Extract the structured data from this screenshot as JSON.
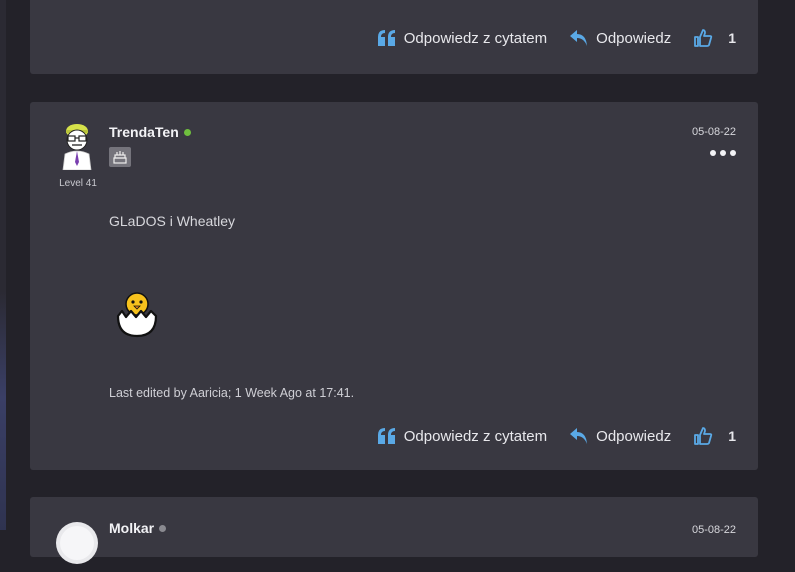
{
  "post1": {
    "actions": {
      "quote_label": "Odpowiedz z cytatem",
      "reply_label": "Odpowiedz",
      "like_count": "1"
    }
  },
  "post2": {
    "username": "TrendaTen",
    "level": "Level 41",
    "date": "05-08-22",
    "body": "GLaDOS i Wheatley",
    "edited": "Last edited by Aaricia; 1 Week Ago at 17:41.",
    "actions": {
      "quote_label": "Odpowiedz z cytatem",
      "reply_label": "Odpowiedz",
      "like_count": "1"
    }
  },
  "post3": {
    "username": "Molkar",
    "date": "05-08-22"
  },
  "colors": {
    "card": "#393841",
    "page": "#232229",
    "accent_icon": "#5aa9e6",
    "online": "#6fbf3e"
  }
}
